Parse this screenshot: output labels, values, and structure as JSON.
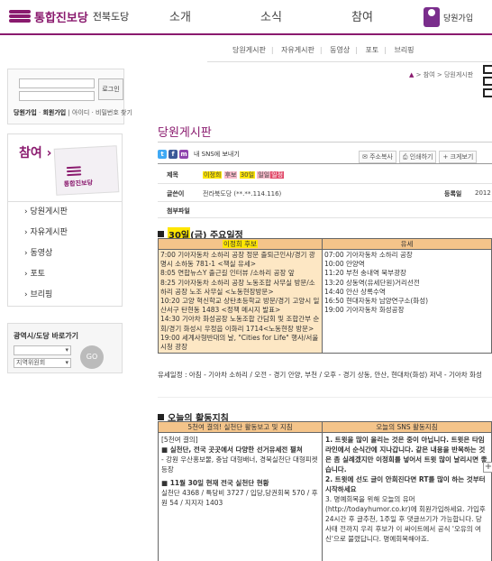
{
  "header": {
    "logo_text": "통합진보당",
    "region": "전북도당",
    "nav": [
      "소개",
      "소식",
      "참여"
    ],
    "join": "당원가입"
  },
  "subnav": [
    "당원게시판",
    "자유게시판",
    "동영상",
    "포토",
    "브리핑"
  ],
  "login": {
    "button": "로그인",
    "links": [
      "당원가입",
      "회원가입",
      "아이디 · 비밀번호 찾기"
    ]
  },
  "side": {
    "title": "참여",
    "banner": "통합진보당",
    "menu": [
      "당원게시판",
      "자유게시판",
      "동영상",
      "포토",
      "브리핑"
    ]
  },
  "region_box": {
    "title": "광역시/도당 바로가기",
    "select1": "",
    "select2": "지역위원회",
    "go": "GO"
  },
  "breadcrumb": [
    "참여",
    "당원게시판"
  ],
  "board_title": "당원게시판",
  "sns_label": "내 SNS에 보내기",
  "tools": [
    "주소복사",
    "인쇄하기",
    "크게보기"
  ],
  "meta": {
    "title_key": "제목",
    "title_parts": [
      "이정희",
      "후보",
      "30일",
      "일일",
      "일정"
    ],
    "author_key": "글쓴이",
    "author_value": "전라북도당 (**.**.114.116)",
    "date_key": "등록일",
    "date_value": "2012",
    "attach_key": "첨부파일"
  },
  "schedule": {
    "heading_prefix": "30일",
    "heading_rest": "(금) 주요일정",
    "col1_head": "이정희 후보",
    "col2_head": "유세",
    "col1_lines": [
      "7:00 기아자동차 소하리 공장 정문 출퇴근인사/경기 광명시 소하동 781-1 <책실 유세>",
      "8:05 연합뉴스Y 출근길 인터뷰 /소하리 공장 앞",
      "8:25 기아자동차 소하리 공장 노동조합 사무실 방문/소하리 공장 노조 사무실 <노동현장방문>",
      "10:20 고양 혁신학교 상탄초등학교 방문/경기 고양시 일산서구 탄현동 1483 <정책 메시지 발표>",
      "14:30 기아차 화성공장 노동조합 간담회 및 조합간부 순회/경기 화성시 우정읍 이화리 1714<노동현장 방문>",
      "19:00 세계사형반대의 날, \"Cities for Life\" 행사/서울시청 광장"
    ],
    "col2_lines": [
      "07:00 기아자동차 소하리 공장",
      "10:00 안양역",
      "11:20 부천 송내역 북부광장",
      "13:20 상동역(유세단원)거리선전",
      "14:40 안산 상록수역",
      "16:50 현대자동차 남양연구소(화성)",
      "19:00 기아자동차 화성공장"
    ],
    "note": "유세일정 : 아침 - 기아차 소하리 / 오전 - 경기 안양, 부천 / 오후 - 경기 상동, 안산, 현대차(화성) 저녁 - 기아차 화성"
  },
  "activity": {
    "heading": "오늘의 활동지침",
    "col1_head": "5천여 결의! 실천단 활동보고 및 지침",
    "col2_head": "오늘의 SNS 활동지침",
    "col1_lines": [
      "[5천여 결의]",
      "■ 실천단, 전국 곳곳에서 다양한 선거유세전 펼쳐",
      "- 강원 우산홍보물, 충남 대형배너, 경북실천단 대형피켓 등장",
      "■ 11월 30일 현재 전국 실천단 현황",
      "실천단 4368 / 특당비 3727 / 입당,당권회복 570 / 후원 54 / 지지자 1403"
    ],
    "col2_lines": [
      "1. 트윗을 많이 올리는 것은 중이 아닙니다. 트윗은 타임라인에서 순식간에 지나갑니다. 같은 내용을 반복하는 것은 좀 실례겠지만 이정희를 넣어서 트윗 많이 날리시면 좋습니다.",
      "2. 트윗에 선도 글이 안희진다면 RT를 많이 하는 것부터 시작하세요",
      "3. 명예회복을 위해 오늘의 유머(http://todayhumor.co.kr)에 회원가입하세요. 가입후 24시간 후 글추천, 1주일 후 댓글쓰기가 가능합니다. 당 사태 전까지 우리 후보가 이 싸이트에서 공식 '오유의 여신'으로 불렸답니다. 명예회복해야죠."
    ]
  },
  "colors": {
    "brand": "#8a1a6e",
    "table_header": "#f4c48a",
    "highlight_yellow": "#ffe600",
    "highlight_pink": "#f6b8c8"
  }
}
